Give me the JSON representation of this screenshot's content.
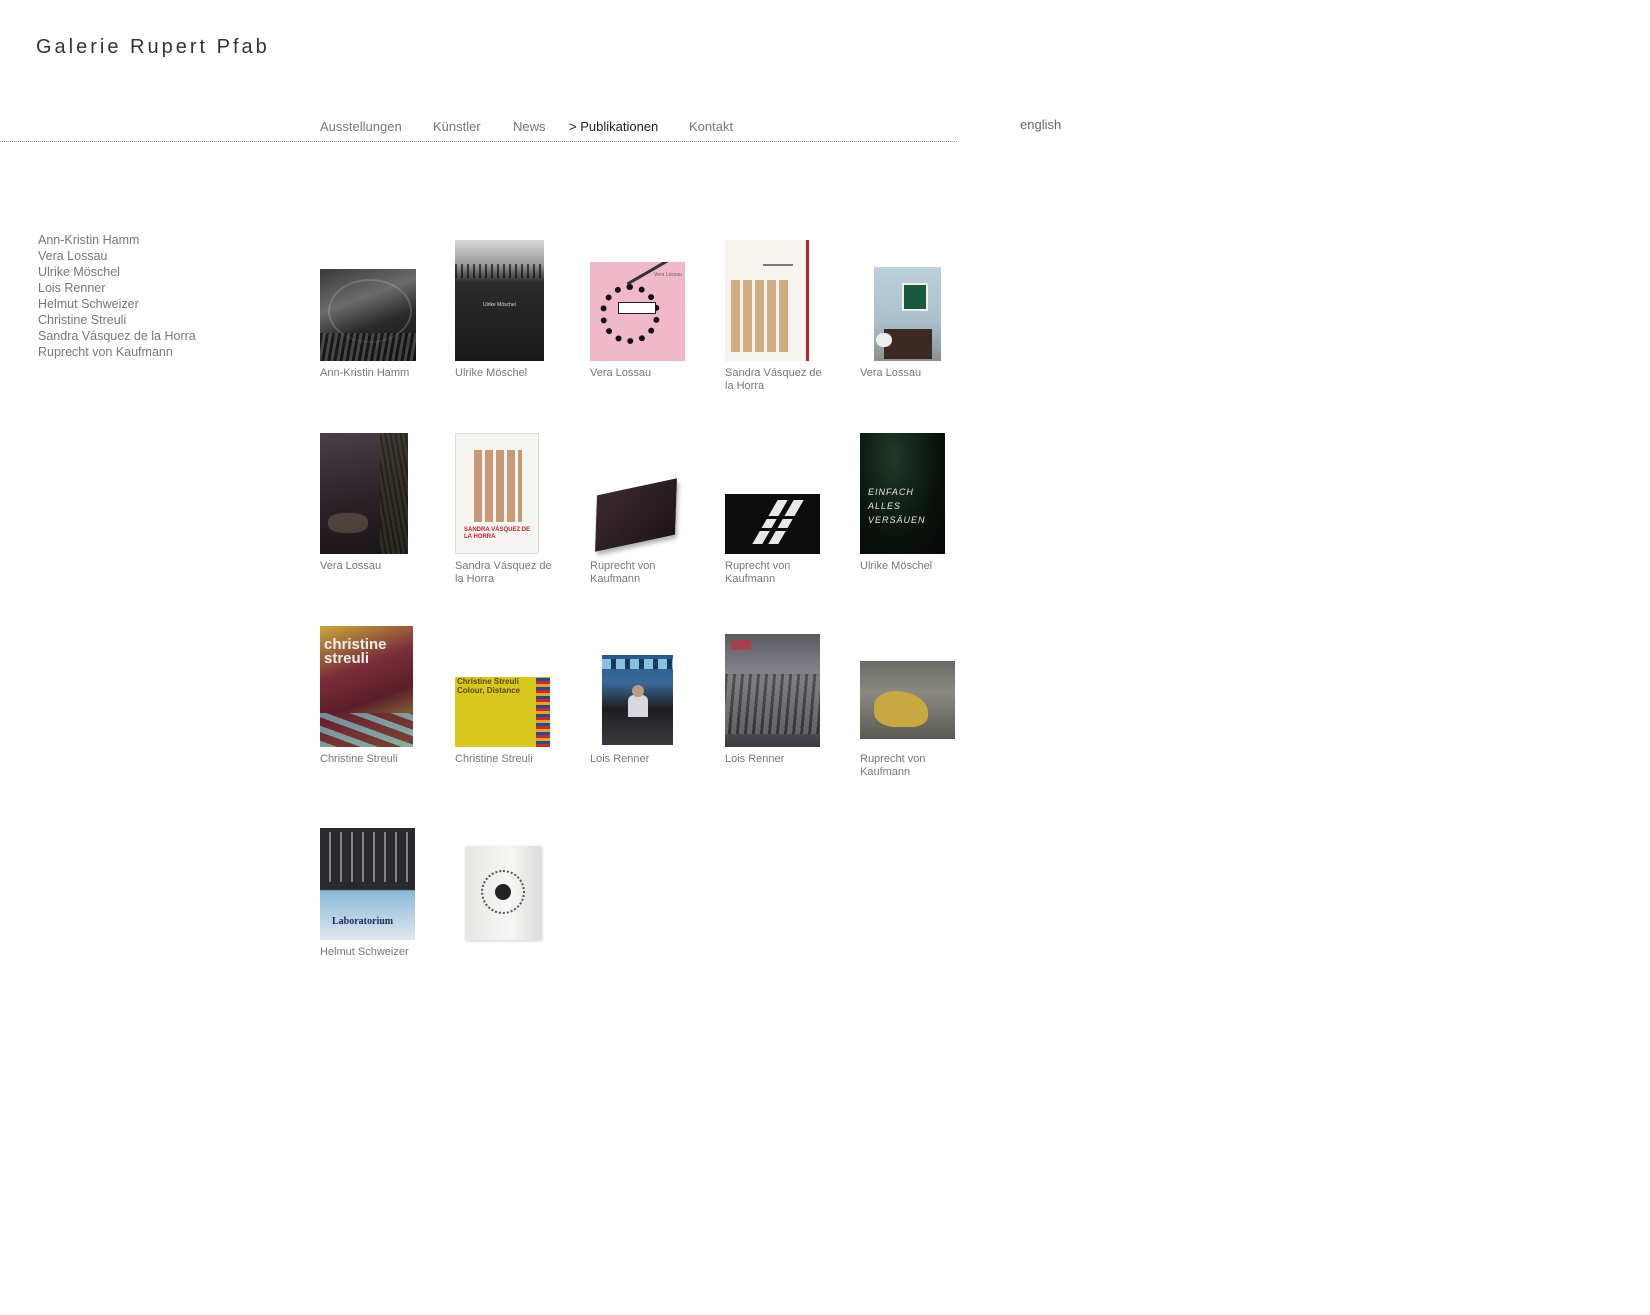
{
  "site": {
    "title": "Galerie Rupert Pfab"
  },
  "nav": {
    "items": [
      {
        "label": "Ausstellungen"
      },
      {
        "label": "Künstler"
      },
      {
        "label": "News"
      },
      {
        "label": "> Publikationen"
      },
      {
        "label": "Kontakt"
      }
    ],
    "language_link": "english"
  },
  "sidebar": {
    "artists": [
      "Ann-Kristin Hamm",
      "Vera Lossau",
      "Ulrike Möschel",
      "Lois Renner",
      "Helmut Schweizer",
      "Christine Streuli",
      "Sandra Vásquez de la Horra",
      "Ruprecht von Kaufmann"
    ]
  },
  "publications": [
    {
      "caption": "Ann-Kristin Hamm"
    },
    {
      "caption": "Ulrike Möschel",
      "cover_text": "Ulrike Möschel"
    },
    {
      "caption": "Vera Lossau",
      "cover_text": "Vera Lossau"
    },
    {
      "caption": "Sandra Vásquez de la Horra"
    },
    {
      "caption": "Vera Lossau"
    },
    {
      "caption": "Vera Lossau"
    },
    {
      "caption": "Sandra Vásquez de la Horra",
      "cover_text": "SANDRA VÁSQUEZ DE LA HORRA"
    },
    {
      "caption": "Ruprecht von Kaufmann"
    },
    {
      "caption": "Ruprecht von Kaufmann"
    },
    {
      "caption": "Ulrike Möschel",
      "cover_text": "EINFACH ALLES VERSÄUEN"
    },
    {
      "caption": "Christine Streuli",
      "cover_text": "christine streuli"
    },
    {
      "caption": "Christine Streuli",
      "cover_text": "Christine Streuli Colour, Distance"
    },
    {
      "caption": "Lois Renner"
    },
    {
      "caption": "Lois Renner"
    },
    {
      "caption": "Ruprecht von Kaufmann"
    },
    {
      "caption": "Helmut Schweizer",
      "cover_text": "Laboratorium"
    },
    {
      "caption": ""
    }
  ]
}
